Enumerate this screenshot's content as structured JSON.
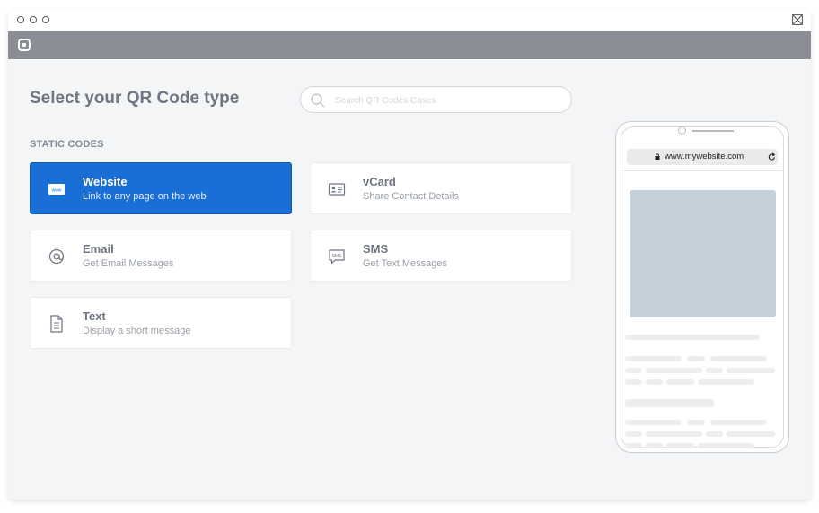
{
  "window": {
    "controls": [
      "circle-icon",
      "circle-icon",
      "circle-icon"
    ],
    "close_icon": "close-box-icon"
  },
  "appbar": {
    "logo_icon": "app-logo-icon"
  },
  "page": {
    "title": "Select your QR Code type",
    "search": {
      "placeholder": "Search QR Codes Cases",
      "value": "",
      "icon": "search-icon"
    },
    "section_label": "STATIC CODES"
  },
  "cards": [
    {
      "title": "Website",
      "subtitle": "Link to any page on the web",
      "icon": "www-icon",
      "selected": true
    },
    {
      "title": "vCard",
      "subtitle": "Share Contact Details",
      "icon": "contact-card-icon",
      "selected": false
    },
    {
      "title": "Email",
      "subtitle": "Get Email Messages",
      "icon": "at-sign-icon",
      "selected": false
    },
    {
      "title": "SMS",
      "subtitle": "Get Text Messages",
      "icon": "sms-bubble-icon",
      "selected": false
    },
    {
      "title": "Text",
      "subtitle": "Display a short message",
      "icon": "document-icon",
      "selected": false
    }
  ],
  "preview": {
    "url": "www.mywebsite.com",
    "lock_icon": "lock-icon",
    "reload_icon": "reload-icon"
  },
  "colors": {
    "accent": "#1a6fd6",
    "background": "#f4f5f7",
    "appbar": "#8a8d93",
    "hero_placeholder": "#c5d1da"
  }
}
